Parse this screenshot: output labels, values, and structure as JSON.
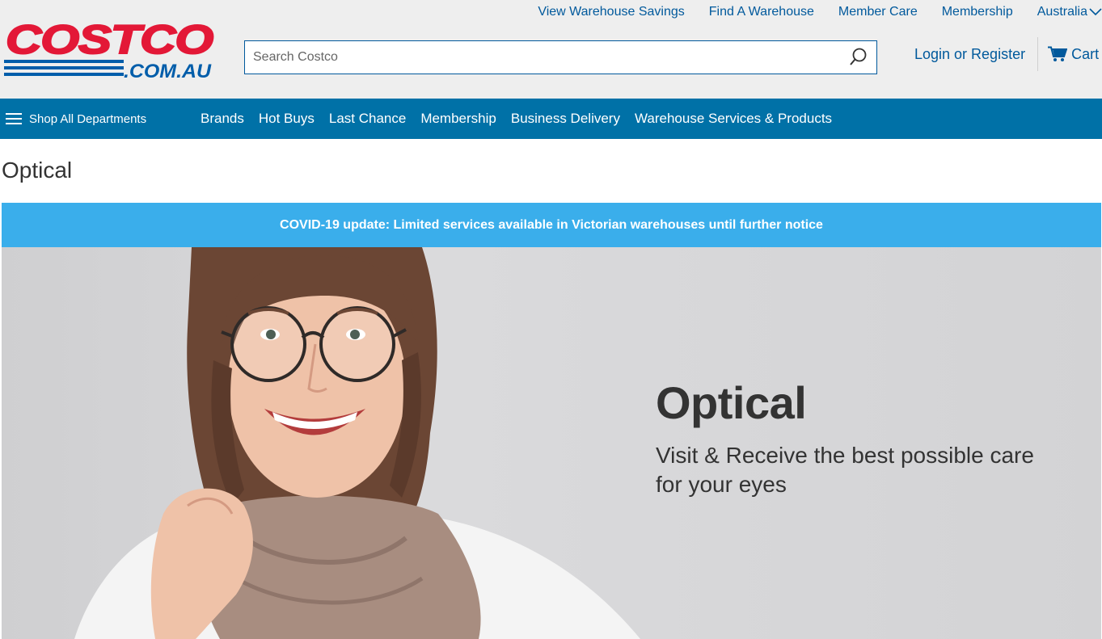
{
  "utility_nav": {
    "items": [
      "View Warehouse Savings",
      "Find A Warehouse",
      "Member Care",
      "Membership"
    ],
    "country": "Australia"
  },
  "logo": {
    "top_text": "COSTCO",
    "bottom_text": ".COM.AU",
    "colors": {
      "red": "#e31837",
      "blue": "#005daa"
    }
  },
  "search": {
    "placeholder": "Search Costco",
    "value": "",
    "icon": "search-icon"
  },
  "account": {
    "login_label": "Login or Register",
    "cart_label": "Cart",
    "cart_icon": "cart-icon"
  },
  "main_nav": {
    "shop_all_label": "Shop All Departments",
    "menu_icon": "hamburger-icon",
    "links": [
      "Brands",
      "Hot Buys",
      "Last Chance",
      "Membership",
      "Business Delivery",
      "Warehouse Services & Products"
    ],
    "bg_color": "#0071a7"
  },
  "page": {
    "title": "Optical"
  },
  "banner": {
    "text": "COVID-19 update: Limited services available in Victorian warehouses until further notice",
    "bg_color": "#3aaeeb"
  },
  "hero": {
    "heading": "Optical",
    "subheading": "Visit & Receive the best possible care for your eyes"
  }
}
